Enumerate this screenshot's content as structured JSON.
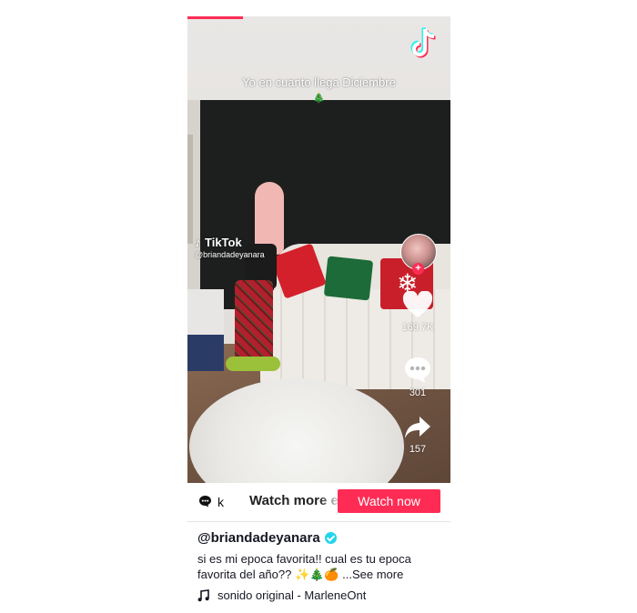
{
  "video": {
    "caption": "Yo en cuanto llega Diciembre",
    "caption_emoji": "🎄",
    "watermark_brand": "TikTok",
    "watermark_handle": "@briandadeyanara",
    "progress_fraction": 0.21
  },
  "actions": {
    "likes": "169.7K",
    "comments": "301",
    "shares": "157",
    "follow_symbol": "+"
  },
  "bar": {
    "comment_preview": "k",
    "watch_more_label": "Watch more e",
    "watch_now_label": "Watch now"
  },
  "post": {
    "username": "@briandadeyanara",
    "description": "si es mi epoca favorita!! cual es tu epoca favorita del año?? ✨🎄🍊 ",
    "see_more": "...See more",
    "sound": "sonido original - MarleneOnt"
  },
  "colors": {
    "accent": "#fe2c55",
    "verified": "#20d5ec",
    "text": "#161823"
  },
  "icons": [
    "tiktok-logo-icon",
    "heart-icon",
    "comment-icon",
    "share-icon",
    "music-note-icon",
    "verified-icon",
    "comment-bubble-icon"
  ]
}
